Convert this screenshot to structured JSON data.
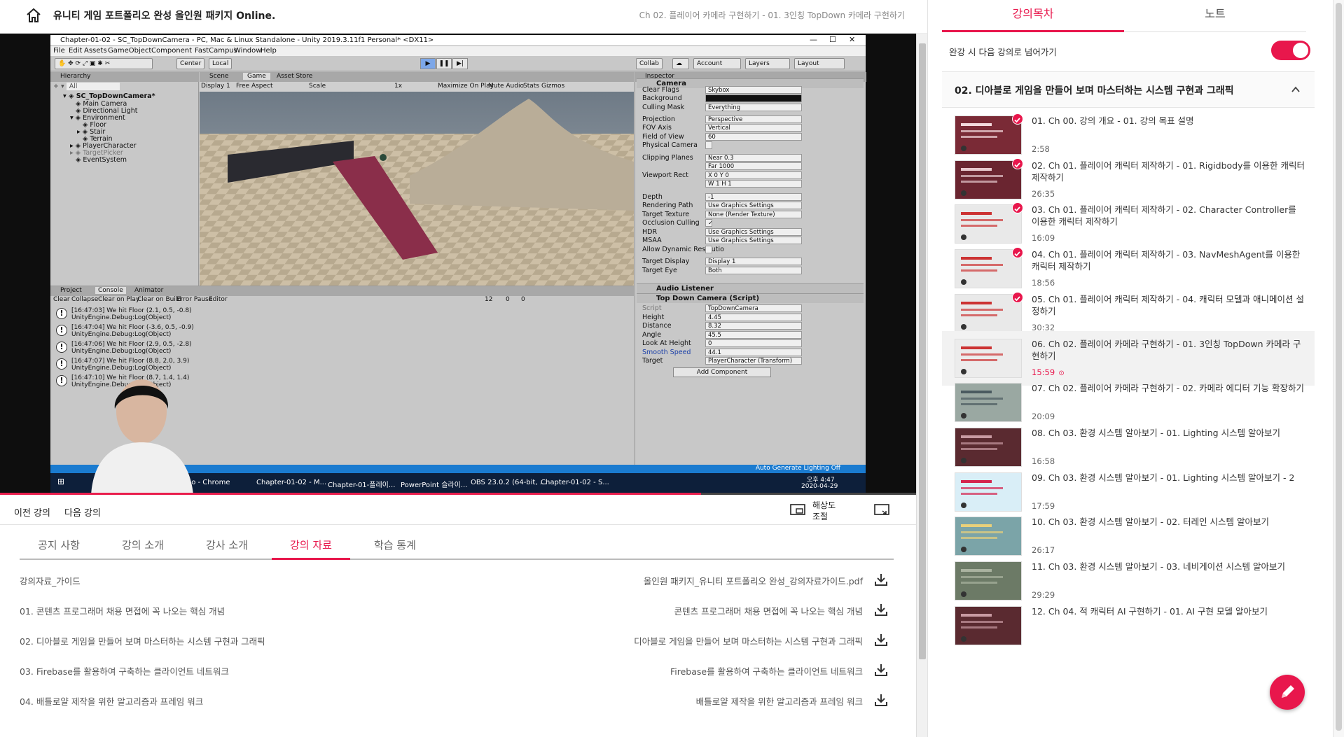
{
  "header": {
    "course_title": "유니티 게임 포트폴리오 완성 올인원 패키지 Online.",
    "current_lecture": "Ch 02. 플레이어 카메라 구현하기 - 01. 3인칭 TopDown 카메라 구현하기"
  },
  "video": {
    "window_title": "Chapter-01-02 - SC_TopDownCamera - PC, Mac & Linux Standalone - Unity 2019.3.11f1 Personal* <DX11>",
    "menu": [
      "File",
      "Edit",
      "Assets",
      "GameObject",
      "Component",
      "FastCampus",
      "Window",
      "Help"
    ],
    "toolbar": {
      "center": "Center",
      "local": "Local",
      "collab": "Collab",
      "account": "Account",
      "layers": "Layers",
      "layout": "Layout"
    },
    "hierarchy": {
      "tab": "Hierarchy",
      "search": "All",
      "scene": "SC_TopDownCamera*",
      "items": [
        "Main Camera",
        "Directional Light",
        "Environment",
        "Floor",
        "Stair",
        "Terrain",
        "PlayerCharacter",
        "TargetPicker",
        "EventSystem"
      ]
    },
    "scene_tabs": [
      "Scene",
      "Game",
      "Asset Store"
    ],
    "game_bar": {
      "display": "Display 1",
      "aspect": "Free Aspect",
      "scale": "Scale",
      "scale_value": "1x",
      "maximize": "Maximize On Play",
      "mute": "Mute Audio",
      "stats": "Stats",
      "gizmos": "Gizmos"
    },
    "inspector": {
      "tab": "Inspector",
      "camera_header": "Camera",
      "rows": [
        {
          "label": "Clear Flags",
          "value": "Skybox"
        },
        {
          "label": "Background",
          "value": ""
        },
        {
          "label": "Culling Mask",
          "value": "Everything"
        },
        {
          "label": "Projection",
          "value": "Perspective"
        },
        {
          "label": "FOV Axis",
          "value": "Vertical"
        },
        {
          "label": "Field of View",
          "value": "60"
        },
        {
          "label": "Physical Camera",
          "value": ""
        },
        {
          "label": "Clipping Planes",
          "value": "Near  0.3"
        },
        {
          "label": "",
          "value": "Far   1000"
        },
        {
          "label": "Viewport Rect",
          "value": "X 0    Y 0"
        },
        {
          "label": "",
          "value": "W 1    H 1"
        },
        {
          "label": "Depth",
          "value": "-1"
        },
        {
          "label": "Rendering Path",
          "value": "Use Graphics Settings"
        },
        {
          "label": "Target Texture",
          "value": "None (Render Texture)"
        },
        {
          "label": "Occlusion Culling",
          "value": "✓"
        },
        {
          "label": "HDR",
          "value": "Use Graphics Settings"
        },
        {
          "label": "MSAA",
          "value": "Use Graphics Settings"
        },
        {
          "label": "Allow Dynamic Resolutio",
          "value": ""
        },
        {
          "label": "Target Display",
          "value": "Display 1"
        },
        {
          "label": "Target Eye",
          "value": "Both"
        }
      ],
      "audio_header": "Audio Listener",
      "script_header": "Top Down Camera (Script)",
      "script_rows": [
        {
          "label": "Script",
          "value": "TopDownCamera"
        },
        {
          "label": "Height",
          "value": "4.45"
        },
        {
          "label": "Distance",
          "value": "8.32"
        },
        {
          "label": "Angle",
          "value": "45.5"
        },
        {
          "label": "Look At Height",
          "value": "0"
        },
        {
          "label": "Smooth Speed",
          "value": "44.1"
        },
        {
          "label": "Target",
          "value": "PlayerCharacter (Transform)"
        }
      ],
      "add_component": "Add Component"
    },
    "console": {
      "tabs": [
        "Project",
        "Console",
        "Animator"
      ],
      "buttons": [
        "Clear",
        "Collapse",
        "Clear on Play",
        "Clear on Build",
        "Error Pause",
        "Editor"
      ],
      "counts": [
        "12",
        "0",
        "0"
      ],
      "logs": [
        {
          "line1": "[16:47:03] We hit Floor (2.1, 0.5, -0.8)",
          "line2": "UnityEngine.Debug:Log(Object)"
        },
        {
          "line1": "[16:47:04] We hit Floor (-3.6, 0.5, -0.9)",
          "line2": "UnityEngine.Debug:Log(Object)"
        },
        {
          "line1": "[16:47:06] We hit Floor (2.9, 0.5, -2.8)",
          "line2": "UnityEngine.Debug:Log(Object)"
        },
        {
          "line1": "[16:47:07] We hit Floor (8.8, 2.0, 3.9)",
          "line2": "UnityEngine.Debug:Log(Object)"
        },
        {
          "line1": "[16:47:10] We hit Floor (8.7, 1.4, 1.4)",
          "line2": "UnityEngine.Debug:Log(Object)"
        }
      ]
    },
    "status_right": "Auto Generate Lighting Off",
    "taskbar": {
      "items": [
        "Mixamo - Chrome",
        "Chapter-01-02 - M...",
        "Chapter-01-플레이...",
        "PowerPoint 슬라이...",
        "OBS 23.0.2 (64-bit, ...",
        "Chapter-01-02 - S..."
      ],
      "time": "오후 4:47",
      "date": "2020-04-29"
    },
    "progress": 0.765
  },
  "controls": {
    "prev": "이전 강의",
    "next": "다음 강의",
    "resolution": "해상도 조절"
  },
  "tabs": [
    {
      "label": "공지 사항",
      "active": false
    },
    {
      "label": "강의 소개",
      "active": false
    },
    {
      "label": "강사 소개",
      "active": false
    },
    {
      "label": "강의 자료",
      "active": true
    },
    {
      "label": "학습 통계",
      "active": false
    }
  ],
  "resources": [
    {
      "name": "강의자료_가이드",
      "file": "올인원 패키지_유니티 포트폴리오 완성_강의자료가이드.pdf"
    },
    {
      "name": "01. 콘텐츠 프로그래머 채용 면접에 꼭 나오는 핵심 개념",
      "file": "콘텐츠 프로그래머 채용 면접에 꼭 나오는 핵심 개념"
    },
    {
      "name": "02. 디아블로 게임을 만들어 보며 마스터하는 시스템 구현과 그래픽",
      "file": "디아블로 게임을 만들어 보며 마스터하는 시스템 구현과 그래픽"
    },
    {
      "name": "03. Firebase를 활용하여 구축하는 클라이언트 네트워크",
      "file": "Firebase를 활용하여 구축하는 클라이언트 네트워크"
    },
    {
      "name": "04. 배틀로얄 제작을 위한 알고리즘과 프레임 워크",
      "file": "배틀로얄 제작을 위한 알고리즘과 프레임 워크"
    }
  ],
  "sidebar": {
    "tabs": [
      "강의목차",
      "노트"
    ],
    "autoplay_label": "완강 시 다음 강의로 넘어가기",
    "autoplay_on": true,
    "section_title": "02. 디아블로 게임을 만들어 보며 마스터하는 시스템 구현과 그래픽",
    "lectures": [
      {
        "title": "01. Ch 00. 강의 개요 - 01. 강의 목표 설명",
        "duration": "2:58",
        "done": true,
        "current": false
      },
      {
        "title": "02. Ch 01. 플레이어 캐릭터 제작하기 - 01. Rigidbody를 이용한 캐릭터 제작하기",
        "duration": "26:35",
        "done": true,
        "current": false
      },
      {
        "title": "03. Ch 01. 플레이어 캐릭터 제작하기 - 02. Character Controller를 이용한 캐릭터 제작하기",
        "duration": "16:09",
        "done": true,
        "current": false
      },
      {
        "title": "04. Ch 01. 플레이어 캐릭터 제작하기 - 03. NavMeshAgent를 이용한 캐릭터 제작하기",
        "duration": "18:56",
        "done": true,
        "current": false
      },
      {
        "title": "05. Ch 01. 플레이어 캐릭터 제작하기 - 04. 캐릭터 모델과 애니메이션 설정하기",
        "duration": "30:32",
        "done": true,
        "current": false
      },
      {
        "title": "06. Ch 02. 플레이어 카메라 구현하기 - 01. 3인칭 TopDown 카메라 구현하기",
        "duration": "15:59",
        "done": false,
        "current": true
      },
      {
        "title": "07. Ch 02. 플레이어 카메라 구현하기 - 02. 카메라 에디터 기능 확장하기",
        "duration": "20:09",
        "done": false,
        "current": false
      },
      {
        "title": "08. Ch 03. 환경 시스템 알아보기 - 01. Lighting 시스템 알아보기",
        "duration": "16:58",
        "done": false,
        "current": false
      },
      {
        "title": "09. Ch 03. 환경 시스템 알아보기 - 01. Lighting 시스템 알아보기 - 2",
        "duration": "17:59",
        "done": false,
        "current": false
      },
      {
        "title": "10. Ch 03. 환경 시스템 알아보기 - 02. 터레인 시스템 알아보기",
        "duration": "26:17",
        "done": false,
        "current": false
      },
      {
        "title": "11. Ch 03. 환경 시스템 알아보기 - 03. 네비게이션 시스템 알아보기",
        "duration": "29:29",
        "done": false,
        "current": false
      },
      {
        "title": "12. Ch 04. 적 캐릭터 AI 구현하기 - 01. AI 구현 모델 알아보기",
        "duration": "",
        "done": false,
        "current": false
      }
    ]
  },
  "colors": {
    "accent": "#e8174c"
  }
}
